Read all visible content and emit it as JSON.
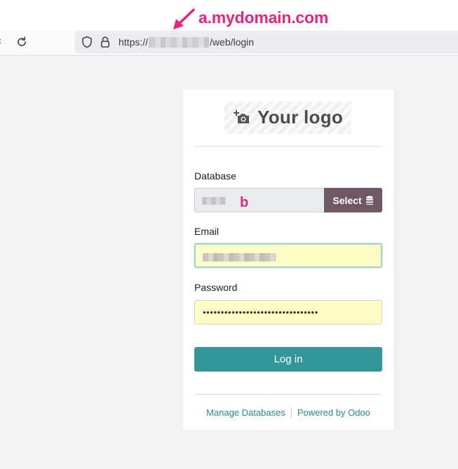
{
  "annotation": {
    "domain_label": "a.mydomain.com",
    "marker_label": "b"
  },
  "browser": {
    "url_prefix": "https://",
    "url_path": "/web/login"
  },
  "logo": {
    "text": "Your logo",
    "icon": "camera-plus-icon"
  },
  "form": {
    "database_label": "Database",
    "select_label": "Select",
    "email_label": "Email",
    "password_label": "Password",
    "password_mask": "••••••••••••••••••••••••••••••••",
    "login_label": "Log in"
  },
  "footer": {
    "manage_databases": "Manage Databases",
    "powered_by": "Powered by Odoo"
  },
  "colors": {
    "annotation": "#e8247c",
    "select_button": "#6e5865",
    "login_button": "#33969a",
    "autofill": "#fefdc6",
    "link": "#2a8a8c"
  }
}
